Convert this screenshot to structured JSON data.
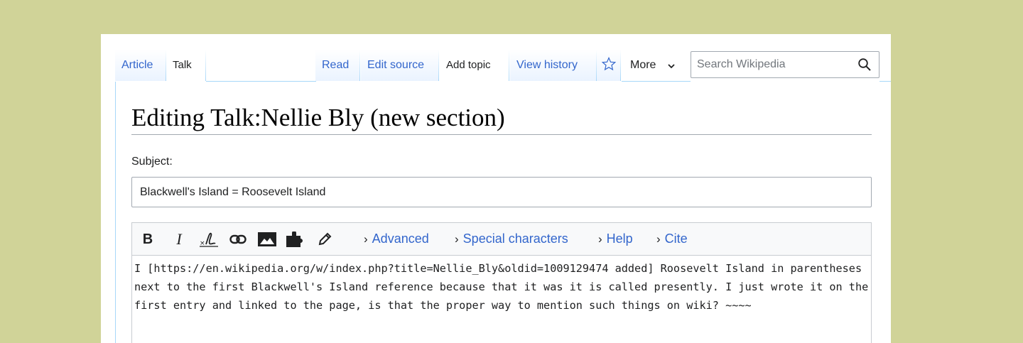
{
  "tabs": {
    "article": "Article",
    "talk": "Talk",
    "read": "Read",
    "edit_source": "Edit source",
    "add_topic": "Add topic",
    "view_history": "View history",
    "more": "More"
  },
  "search": {
    "placeholder": "Search Wikipedia"
  },
  "page_title": "Editing Talk:Nellie Bly (new section)",
  "subject": {
    "label": "Subject:",
    "value": "Blackwell's Island = Roosevelt Island"
  },
  "toolbar": {
    "bold": "B",
    "italic": "I",
    "advanced": "Advanced",
    "special_characters": "Special characters",
    "help": "Help",
    "cite": "Cite"
  },
  "editor_text": "I [https://en.wikipedia.org/w/index.php?title=Nellie_Bly&oldid=1009129474 added] Roosevelt Island in parentheses next to the first Blackwell's Island reference because that it was it is called presently. I just wrote it on the first entry and linked to the page, is that the proper way to mention such things on wiki? ~~~~",
  "colors": {
    "link": "#3366cc",
    "background": "#d0d398",
    "border": "#a7d7f9"
  }
}
